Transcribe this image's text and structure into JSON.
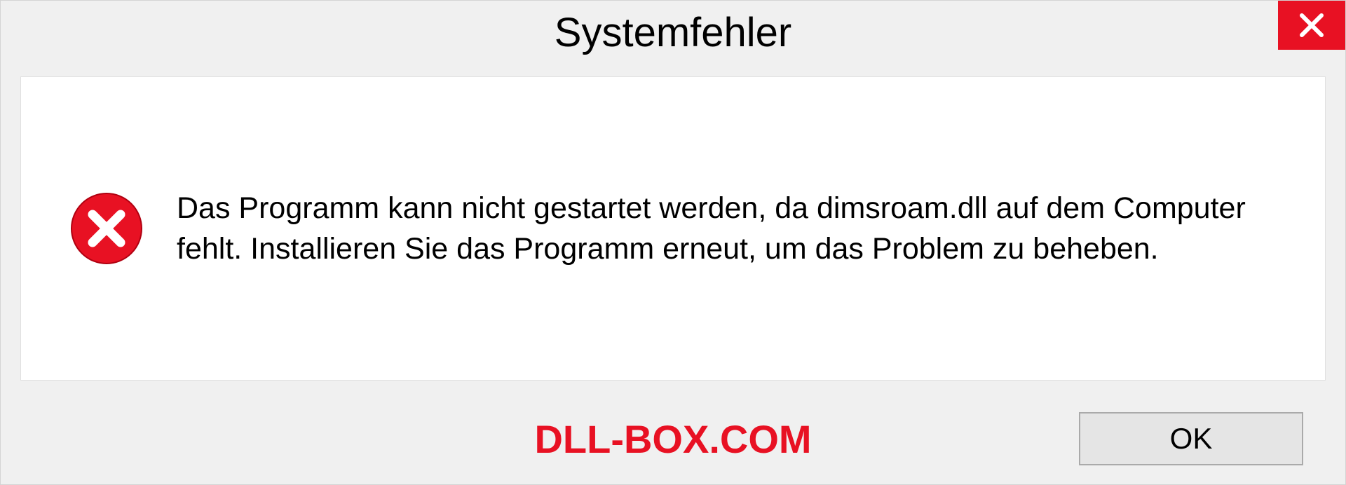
{
  "dialog": {
    "title": "Systemfehler",
    "message": "Das Programm kann nicht gestartet werden, da dimsroam.dll auf dem Computer fehlt. Installieren Sie das Programm erneut, um das Problem zu beheben.",
    "ok_label": "OK"
  },
  "watermark": "DLL-BOX.COM"
}
